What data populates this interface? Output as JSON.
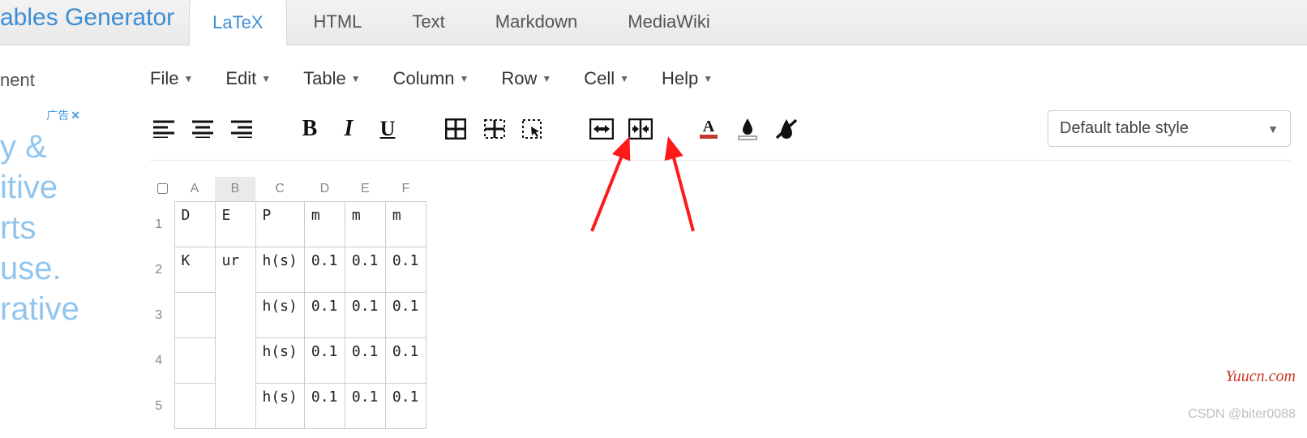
{
  "brand": "ables Generator",
  "tabs": [
    {
      "label": "LaTeX",
      "active": true
    },
    {
      "label": "HTML",
      "active": false
    },
    {
      "label": "Text",
      "active": false
    },
    {
      "label": "Markdown",
      "active": false
    },
    {
      "label": "MediaWiki",
      "active": false
    }
  ],
  "left_truncated": "nent",
  "ad": {
    "label": "广告",
    "ghost": "y &\nitive\nrts\nuse.\nrative"
  },
  "menus": [
    "File",
    "Edit",
    "Table",
    "Column",
    "Row",
    "Cell",
    "Help"
  ],
  "style_select": {
    "value": "Default table style"
  },
  "sheet": {
    "columns": [
      "A",
      "B",
      "C",
      "D",
      "E",
      "F"
    ],
    "selected_column_index": 1,
    "rows": [
      {
        "n": 1,
        "cells": [
          "D",
          "E",
          "P",
          "m",
          "m",
          "m"
        ]
      },
      {
        "n": 2,
        "cells": [
          "K",
          "ur",
          "h(s)",
          "0.1",
          "0.1",
          "0.1"
        ]
      },
      {
        "n": 3,
        "cells": [
          "",
          null,
          "h(s)",
          "0.1",
          "0.1",
          "0.1"
        ]
      },
      {
        "n": 4,
        "cells": [
          "",
          null,
          "h(s)",
          "0.1",
          "0.1",
          "0.1"
        ]
      },
      {
        "n": 5,
        "cells": [
          "",
          null,
          "h(s)",
          "0.1",
          "0.1",
          "0.1"
        ]
      }
    ],
    "merge": {
      "col": 1,
      "from_row": 2,
      "to_row": 5
    }
  },
  "watermarks": {
    "site": "Yuucn.com",
    "author": "CSDN @biter0088"
  }
}
